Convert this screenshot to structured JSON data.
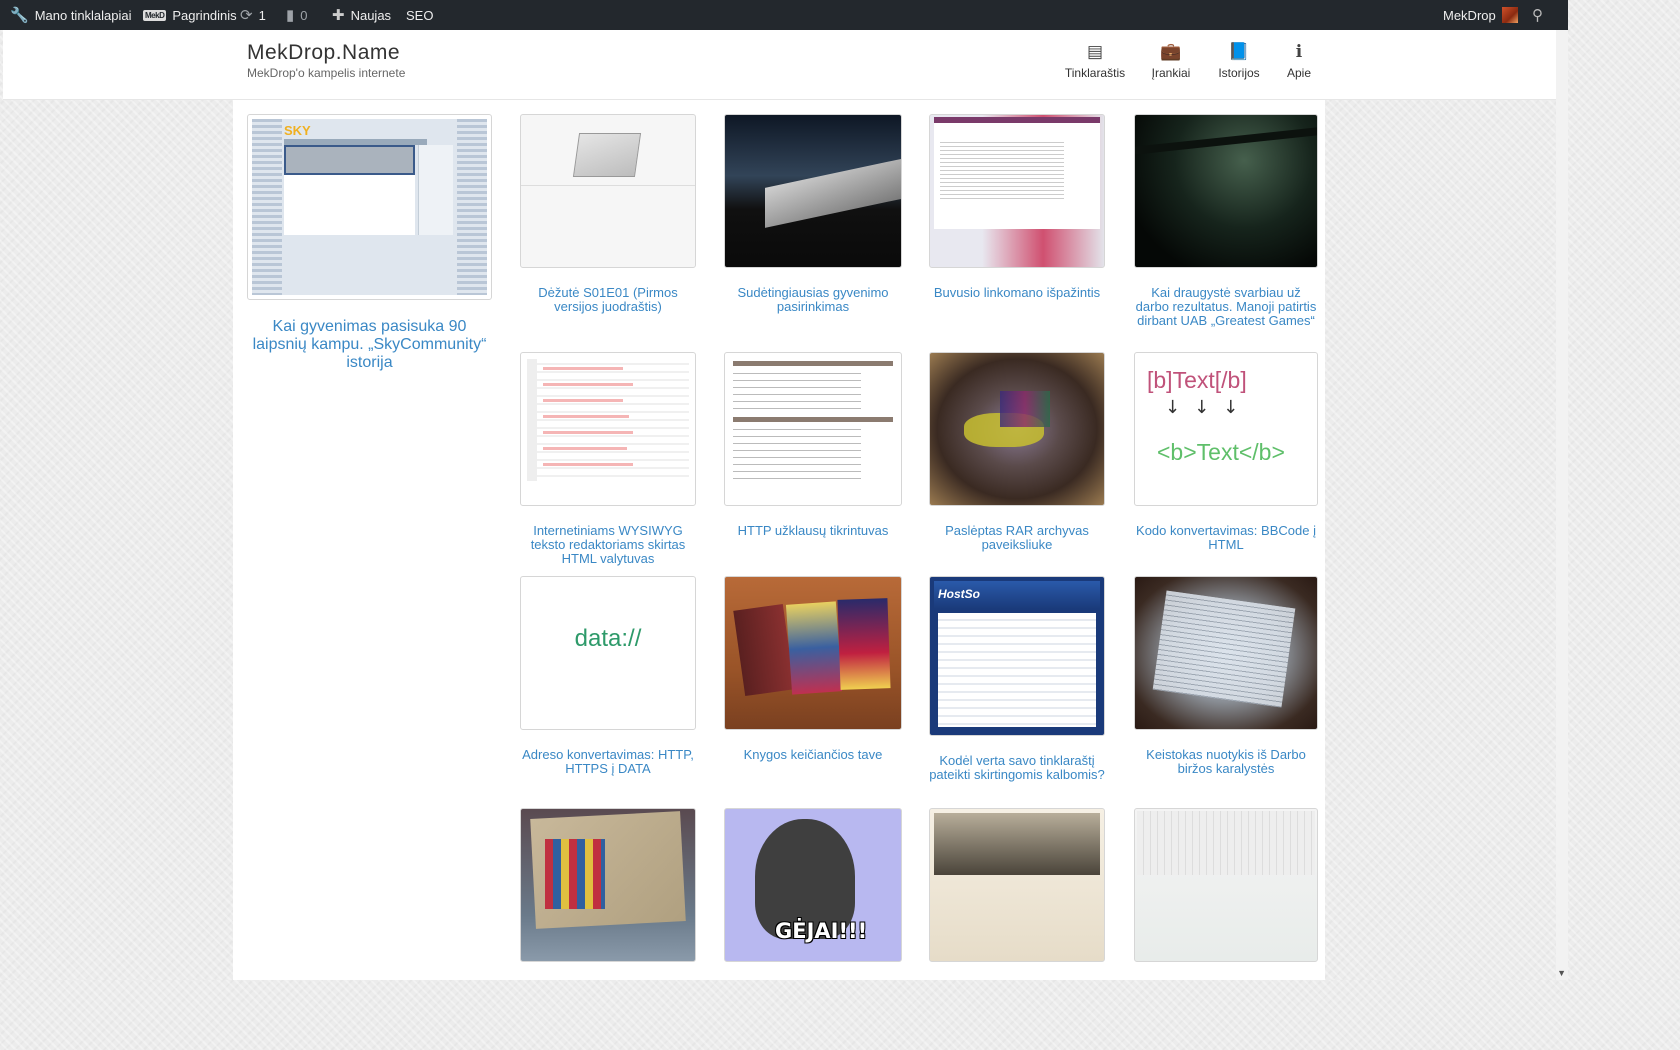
{
  "adminbar": {
    "my_sites": "Mano tinklalapiai",
    "site_badge": "MekD",
    "site_name": "Pagrindinis",
    "updates": "1",
    "comments": "0",
    "new": "Naujas",
    "seo": "SEO",
    "user": "MekDrop"
  },
  "site": {
    "title": "MekDrop.Name",
    "description": "MekDrop'o kampelis internete"
  },
  "nav": [
    {
      "label": "Tinklaraštis",
      "icon": "newspaper-icon"
    },
    {
      "label": "Įrankiai",
      "icon": "briefcase-icon"
    },
    {
      "label": "Istorijos",
      "icon": "book-icon"
    },
    {
      "label": "Apie",
      "icon": "info-icon"
    }
  ],
  "featured": {
    "caption": "Kai gyvenimas pasisuka 90 laipsnių kampu. „SkyCommunity“ istorija",
    "thumb_logo": "SKY"
  },
  "posts": [
    {
      "caption": "Dėžutė S01E01 (Pirmos versijos juodraštis)"
    },
    {
      "caption": "Sudėtingiausias gyvenimo pasirinkimas"
    },
    {
      "caption": "Buvusio linkomano išpažintis"
    },
    {
      "caption": "Kai draugystė svarbiau už darbo rezultatus. Manoji patirtis dirbant UAB „Greatest Games“"
    },
    {
      "caption": "Internetiniams WYSIWYG teksto redaktoriams skirtas HTML valytuvas"
    },
    {
      "caption": "HTTP užklausų tikrintuvas"
    },
    {
      "caption": "Paslėptas RAR archyvas paveiksliuke"
    },
    {
      "caption": "Kodo konvertavimas: BBCode į HTML",
      "thumb_top": "[b]Text[/b]",
      "thumb_arrows": "↓↓↓",
      "thumb_bottom": "<b>Text</b>"
    },
    {
      "caption": "Adreso konvertavimas: HTTP, HTTPS į DATA",
      "thumb_text": "data://"
    },
    {
      "caption": "Knygos keičiančios tave"
    },
    {
      "caption": "Kodėl verta savo tinklaraštį pateikti skirtingomis kalbomis?",
      "thumb_text": "HostSo"
    },
    {
      "caption": "Keistokas nuotykis iš Darbo biržos karalystės"
    },
    {
      "caption": ""
    },
    {
      "caption": "",
      "thumb_text": "GĖJAI!!!"
    },
    {
      "caption": ""
    },
    {
      "caption": ""
    }
  ]
}
